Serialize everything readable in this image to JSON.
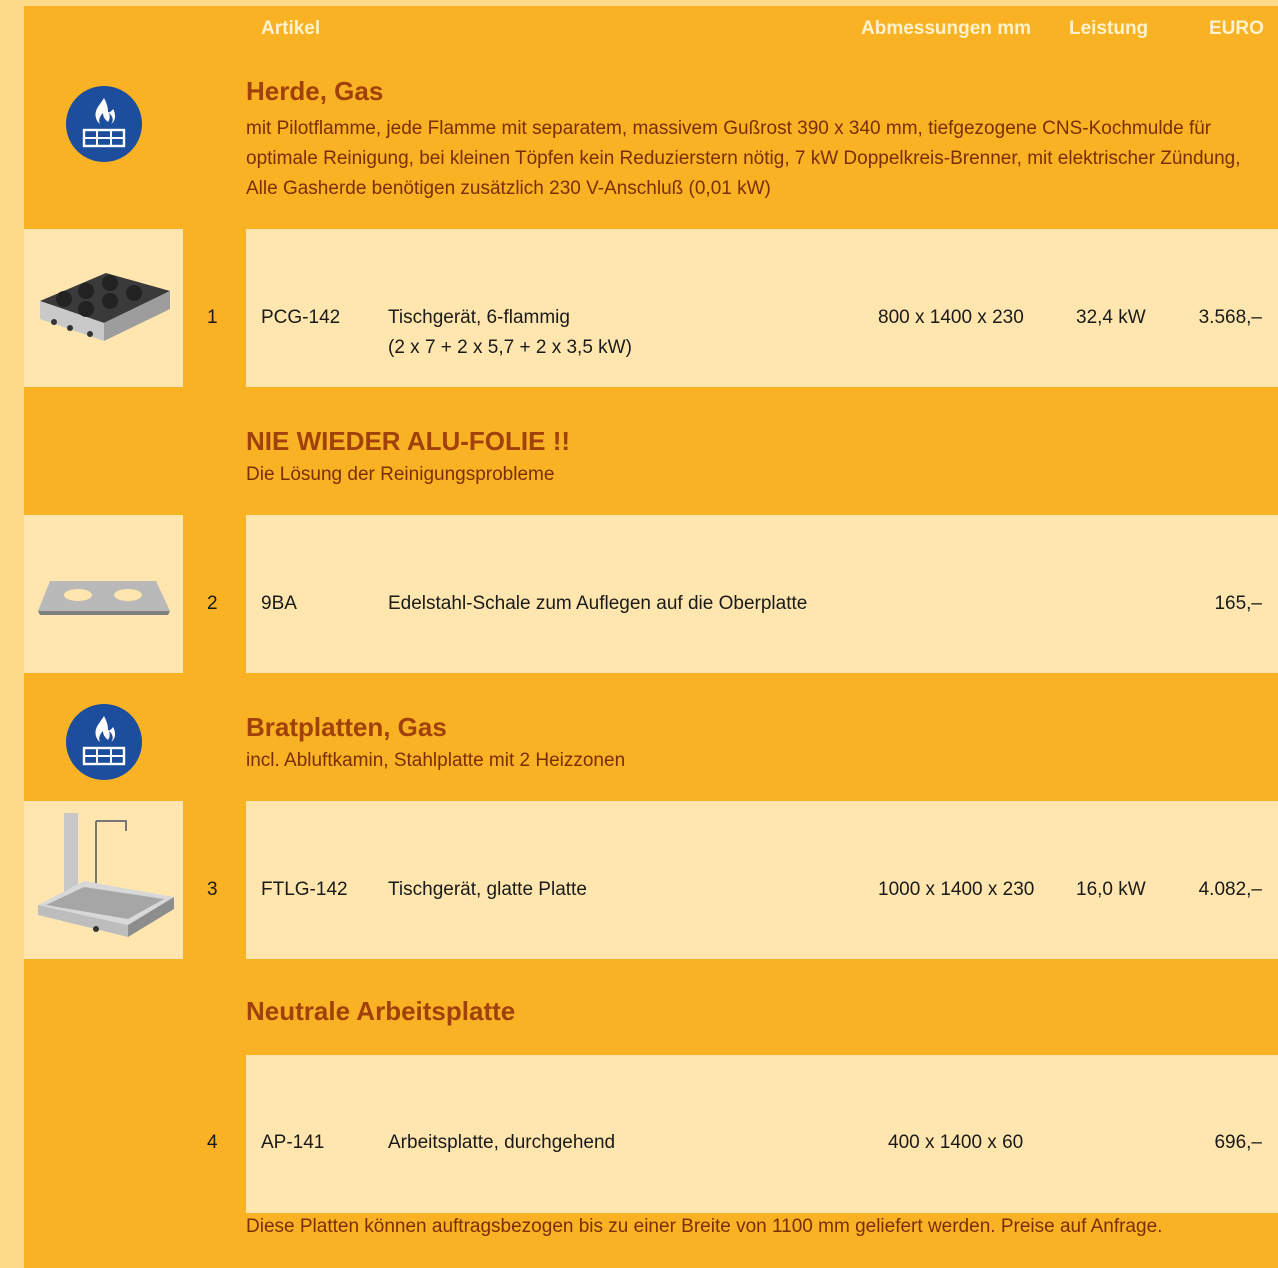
{
  "header": {
    "artikel": "Artikel",
    "abmessungen": "Abmessungen mm",
    "leistung": "Leistung",
    "euro": "EURO"
  },
  "sections": [
    {
      "title": "Herde, Gas",
      "description": "mit Pilotflamme, jede Flamme mit separatem, massivem Gußrost 390 x 340 mm, tiefgezogene CNS-Kochmulde für optimale Reinigung, bei kleinen Töpfen kein Reduzierstern nötig, 7 kW Doppelkreis-Brenner, mit elektrischer Zündung, Alle Gasherde benötigen zusätzlich 230 V-Anschluß (0,01 kW)",
      "icon": "gas-flame-icon"
    },
    {
      "title": "NIE WIEDER ALU-FOLIE !!",
      "description": "Die Lösung der Reinigungsprobleme"
    },
    {
      "title": "Bratplatten, Gas",
      "description": "incl. Abluftkamin, Stahlplatte mit 2 Heizzonen",
      "icon": "gas-flame-icon"
    },
    {
      "title": "Neutrale Arbeitsplatte"
    }
  ],
  "items": [
    {
      "num": "1",
      "code": "PCG-142",
      "desc": "Tischgerät, 6-flammig",
      "desc2": "(2 x 7 + 2 x 5,7 + 2 x 3,5 kW)",
      "dim": "800 x 1400 x 230",
      "power": "32,4 kW",
      "price": "3.568,–"
    },
    {
      "num": "2",
      "code": "9BA",
      "desc": "Edelstahl-Schale zum Auflegen auf die Oberplatte",
      "price": "165,–"
    },
    {
      "num": "3",
      "code": "FTLG-142",
      "desc": "Tischgerät, glatte Platte",
      "dim": "1000 x 1400 x 230",
      "power": "16,0 kW",
      "price": "4.082,–"
    },
    {
      "num": "4",
      "code": "AP-141",
      "desc": "Arbeitsplatte, durchgehend",
      "dim": "400 x 1400 x 60",
      "price": "696,–"
    }
  ],
  "footer": "Diese Platten können auftragsbezogen bis zu einer Breite von 1100 mm geliefert werden. Preise auf Anfrage.",
  "colors": {
    "page_bg": "#F9B224",
    "row_bg": "#FFE6AE",
    "title": "#A0400A",
    "icon_bg": "#1D4E9E"
  }
}
